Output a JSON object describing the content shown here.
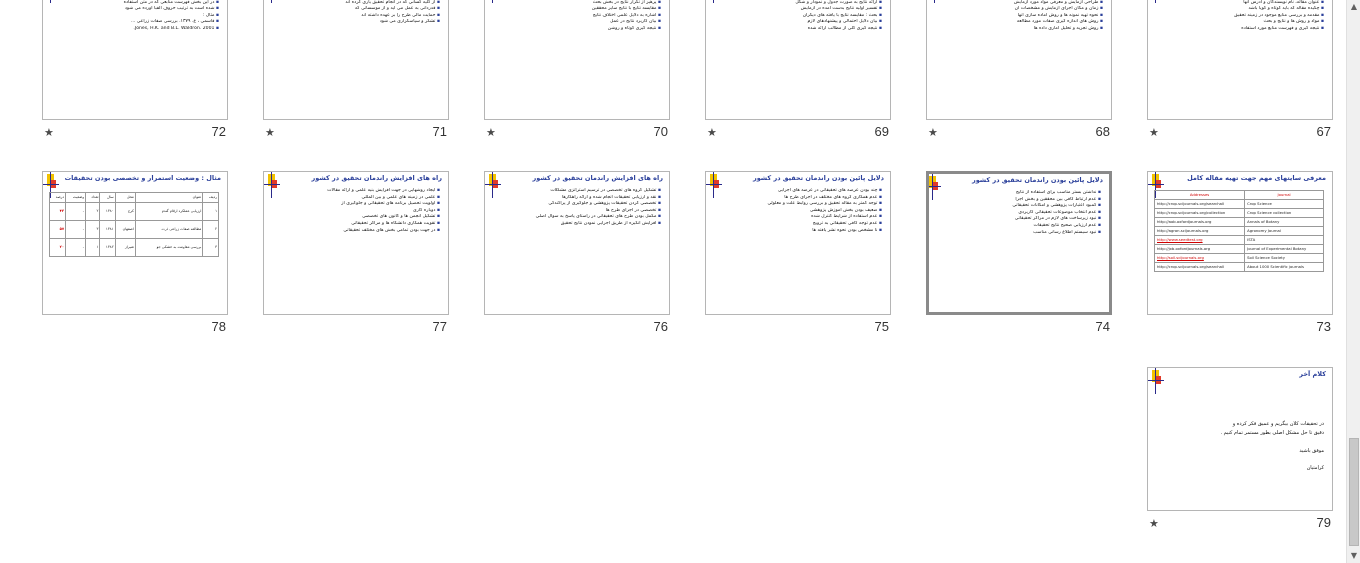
{
  "slides": [
    {
      "num": "67",
      "title": "ساختار مقالات و پایان نامه",
      "lines": [
        "قسمت های اصلی یک مقاله و پایان نامه عبارتند از :",
        "عنوان مقاله، نام نویسندگان و آدرس آنها",
        "چکیده مقاله که باید کوتاه و گویا باشد",
        "مقدمه و بررسی منابع موجود در زمینه تحقیق",
        "مواد و روش ها و نتایج و بحث",
        "نتیجه گیری و فهرست منابع مورد استفاده"
      ],
      "star": true
    },
    {
      "num": "68",
      "title": "ساختار مقالات و پایان نامه",
      "lines": [
        "مواد و روشها :",
        "طراحی آزمایش و معرفی مواد مورد آزمایش",
        "زمان و مکان اجرای آزمایش و مشخصات آن",
        "نحوه تهیه نمونه ها و روش آماده سازی آنها",
        "روش های اندازه گیری صفات مورد مطالعه",
        "روش تجزیه و تحلیل آماری داده ها"
      ],
      "star": true
    },
    {
      "num": "69",
      "title": "ساختار مقالات و پایان نامه",
      "lines": [
        "نتایج : این بخش شامل یافته های حاصل می باشد",
        "ارائه نتایج به صورت جدول و نمودار و شکل",
        "تفسیر اولیه نتایج بدست آمده در آزمایش",
        "بحث : مقایسه نتایج با یافته های دیگران",
        "بیان دلایل احتمالی و پیشنهادهای لازم",
        "نتیجه گیری کلی از مطالب ارائه شده"
      ],
      "star": true
    },
    {
      "num": "70",
      "title": "ساختار مقالات و پایان نامه",
      "lines": [
        "نکات مهم در نگارش بحث :",
        "پرهیز از تکرار نتایج در بخش بحث",
        "مقایسه نتایج با نتایج سایر محققین",
        "اشاره به دلایل علمی اختلاف نتایج",
        "بیان کاربرد نتایج در عمل",
        "نتیجه گیری کوتاه و روشن"
      ],
      "star": true
    },
    {
      "num": "71",
      "title": "ساختار مقالات و پایان نامه",
      "lines": [
        "تشکر و قدردانی",
        "از کلیه کسانی که در انجام تحقیق یاری کرده اند",
        "قدردانی به عمل می آید و از موسساتی که",
        "حمایت مالی طرح را بر عهده داشته اند",
        "تشکر و سپاسگزاری می شود"
      ],
      "star": true
    },
    {
      "num": "72",
      "title": "ساختار مقالات و پایان نامه",
      "lines": [
        "منابع مورد استفاده",
        "در این بخش فهرست منابعی که در متن استفاده",
        "شده است به ترتیب حروف الفبا آورده می شود",
        "مثال :",
        "قاسمی ، ع. ۱۳۷۹. بررسی صفات زراعی ...",
        "Jones, H.K. and B.L. Waldron. 2001."
      ],
      "star": true
    },
    {
      "num": "73",
      "title": "معرفی سایتهای مهم جهت تهیه مقاله کامل",
      "type": "links",
      "links_head": [
        "Journal",
        "Addresses"
      ],
      "rows": [
        [
          "Crop Science",
          "http://crop.scijournals.org/searchall"
        ],
        [
          "Crop Science collection",
          "http://crop.scijournals.org/collection"
        ],
        [
          "Annals of Botany",
          "http://aob.oxfordjournals.org"
        ],
        [
          "Agronomy Journal",
          "http://agron.scijournals.org"
        ],
        [
          "ISTA",
          "http://www.seedtest.org"
        ],
        [
          "Journal of Experimental Botany",
          "http://jxb.oxfordjournals.org"
        ],
        [
          "Soil Science Society",
          "http://soil.scijournals.org"
        ],
        [
          "About 1000 Scientific journals",
          "http://crop.scijournals.org/searchall"
        ]
      ],
      "star": false
    },
    {
      "num": "74",
      "title": "دلایل پائین بودن راندمان تحقیق در کشور",
      "lines": [
        "نداشتن بستر مناسب برای استفاده از نتایج",
        "عدم ارتباط کافی بین محققین و بخش اجرا",
        "کمبود اعتبارات پژوهشی و امکانات تحقیقاتی",
        "عدم انتخاب موضوعات تحقیقاتی کاربردی",
        "نبود زیرساخت های لازم در مراکز تحقیقاتی",
        "عدم ارزیابی صحیح نتایج تحقیقات",
        "نبود سیستم اطلاع رسانی مناسب"
      ],
      "star": false,
      "selected": true
    },
    {
      "num": "75",
      "title": "دلایل پائین بودن راندمان تحقیق در کشور",
      "lines": [
        "چند بودن عرصه های تحقیقاتی در عرضه های اجرایی",
        "عدم همکاری گروه های مختلف در اجرای طرح ها",
        "توجه کمتر به مقاله تحقیق و بررسی روابط علت و معلولی",
        "ضعیف بودن بخش آموزش پژوهشی",
        "عدم استفاده از شرایط کنترل شده",
        "عدم توجه کافی تحقیقاتی به ترویج",
        "نا مشخص بودن نحوه نشر یافته ها"
      ],
      "star": false
    },
    {
      "num": "76",
      "title": "راه های افزایش راندمان تحقیق در کشور",
      "lines": [
        "تشکیل گروه های تخصصی در ترسیم استراتژی مشکلات",
        "نقد و ارزیابی تحقیقات انجام شده و ارائه راهکارها",
        "تخصصی کردن تحقیقات پژوهشی و جلوگیری از پراکندگی",
        "تخصصی در اجرای طرح ها",
        "مکمل بودن طرح های تحقیقاتی در راستای پاسخ به سوال اصلی",
        "افزایش انگیزه از طریق اجرایی نمودن نتایج تحقیق"
      ],
      "star": false
    },
    {
      "num": "77",
      "title": "راه های افزایش راندمان تحقیق در کشور",
      "lines": [
        "ایجاد روشهایی در جهت افزایش بنیه علمی و ارائه مقالات",
        "علمی در زمینه های علمی و بین المللی",
        "اولویت تحصیل برنامه های تحقیقاتی و جلوگیری از",
        "دوباره کاری",
        "تشکیل انجمن ها و کانون های تخصصی",
        "تقویت همکاری دانشگاه ها و مراکز تحقیقاتی",
        "در جهت بودن تمامی بخش های مختلف تحقیقاتی"
      ],
      "star": false
    },
    {
      "num": "78",
      "title": "مثال : وضعیت استمرار و تخصصی بودن تحقیقات",
      "type": "table",
      "cols": [
        "ردیف",
        "عنوان",
        "محل",
        "سال",
        "تعداد",
        "وضعیت",
        "درصد"
      ],
      "rows": [
        [
          "۱",
          "ارزیابی عملکرد ارقام گندم",
          "کرج",
          "۱۳۸۰",
          "۲",
          "-",
          "۴۳"
        ],
        [
          "۲",
          "مطالعه صفات زراعی ذرت",
          "اصفهان",
          "۱۳۸۱",
          "۳",
          "-",
          "۵۷"
        ],
        [
          "۳",
          "بررسی مقاومت به خشکی جو",
          "شیراز",
          "۱۳۸۲",
          "۱",
          "-",
          "۲۰"
        ]
      ],
      "star": false
    },
    {
      "num": "79",
      "title": "کلام آخر",
      "lines": [
        "در تحقیقات کلان بیگریم و عمیق فکر کرده و",
        "دقیق تا حل مشکل اصلی بطور مستمر تمام کنیم ."
      ],
      "sign": [
        "موفق باشید",
        "کرامتیان"
      ],
      "star": true
    }
  ],
  "icons": {
    "star": "star-icon",
    "scroll_up": "scroll-up-arrow-icon",
    "scroll_down": "scroll-down-arrow-icon"
  },
  "glyphs": {
    "star": "★",
    "up": "▲",
    "down": "▼"
  },
  "colors": {
    "title": "#2a3f9a",
    "accent_red": "#d00000",
    "selected_border": "#8a8a8a"
  }
}
